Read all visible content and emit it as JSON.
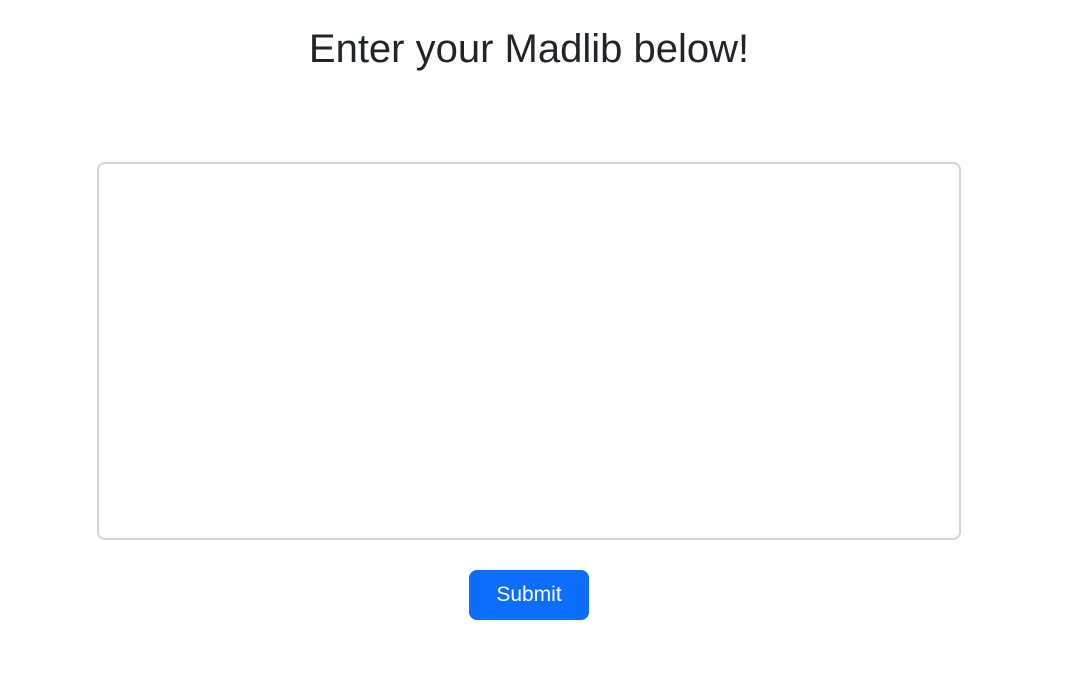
{
  "page": {
    "title": "Enter your Madlib below!"
  },
  "form": {
    "madlib_input_value": "",
    "submit_label": "Submit"
  },
  "colors": {
    "accent": "#0d6efd",
    "text": "#212529",
    "input_border": "#ced4da"
  }
}
